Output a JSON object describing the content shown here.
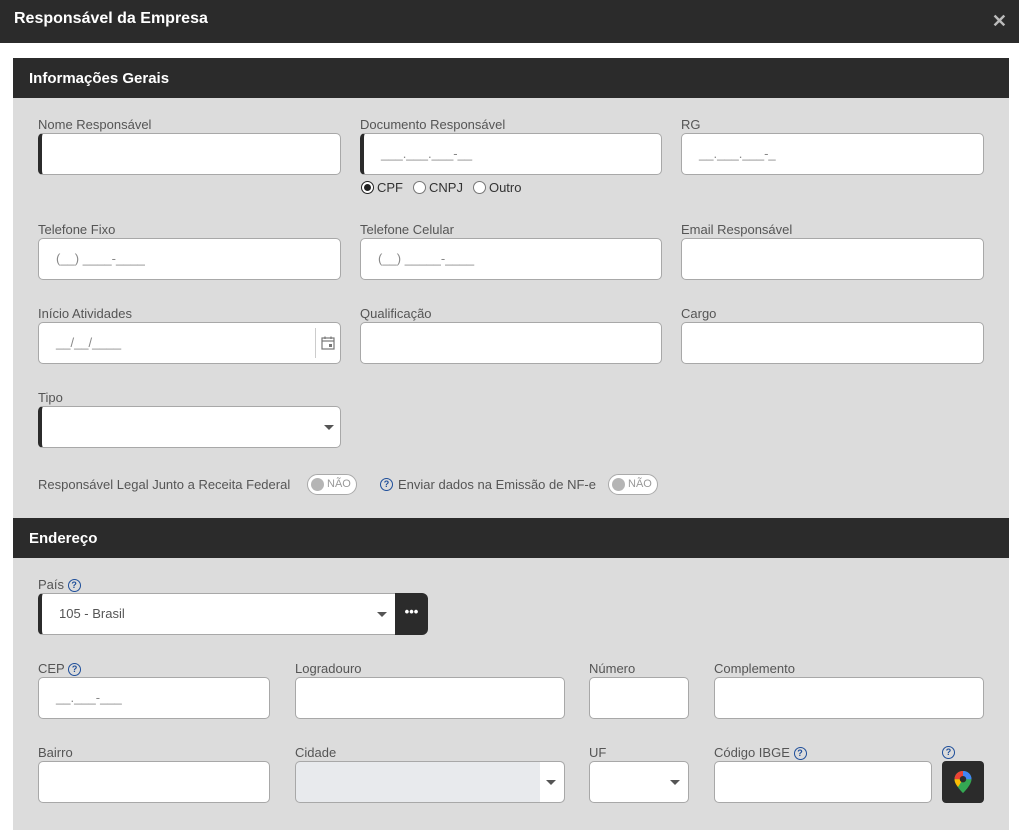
{
  "dialog": {
    "title": "Responsável da Empresa",
    "close_glyph": "✕"
  },
  "section_general": {
    "title": "Informações Gerais",
    "nome": {
      "label": "Nome Responsável",
      "value": ""
    },
    "documento": {
      "label": "Documento Responsável",
      "placeholder": "___.___.___-__"
    },
    "doc_types": [
      "CPF",
      "CNPJ",
      "Outro"
    ],
    "doc_type_selected": "CPF",
    "rg": {
      "label": "RG",
      "placeholder": "__.___.___-_"
    },
    "telefone_fixo": {
      "label": "Telefone Fixo",
      "placeholder": "(__) ____-____"
    },
    "telefone_celular": {
      "label": "Telefone Celular",
      "placeholder": "(__) _____-____"
    },
    "email": {
      "label": "Email Responsável",
      "value": ""
    },
    "inicio": {
      "label": "Início Atividades",
      "placeholder": "__/__/____"
    },
    "qualificacao": {
      "label": "Qualificação",
      "value": ""
    },
    "cargo": {
      "label": "Cargo",
      "value": ""
    },
    "tipo": {
      "label": "Tipo",
      "value": ""
    },
    "responsavel_legal": {
      "label": "Responsável Legal Junto a Receita Federal",
      "toggle": "NÃO"
    },
    "enviar_nfe": {
      "label": "Enviar dados na Emissão de NF-e",
      "toggle": "NÃO"
    }
  },
  "section_address": {
    "title": "Endereço",
    "pais": {
      "label": "País",
      "value": "105 - Brasil"
    },
    "cep": {
      "label": "CEP",
      "placeholder": "__.___-___"
    },
    "logradouro": {
      "label": "Logradouro",
      "value": ""
    },
    "numero": {
      "label": "Número",
      "value": ""
    },
    "complemento": {
      "label": "Complemento",
      "value": ""
    },
    "bairro": {
      "label": "Bairro",
      "value": ""
    },
    "cidade": {
      "label": "Cidade",
      "value": ""
    },
    "uf": {
      "label": "UF",
      "value": ""
    },
    "ibge": {
      "label": "Código IBGE",
      "value": ""
    }
  },
  "icons": {
    "help": "?",
    "more": "•••",
    "map": "map-pin-icon",
    "calendar": "calendar-icon"
  },
  "colors": {
    "header_bg": "#2b2b2b",
    "panel_bg": "#dcdcdc",
    "help_blue": "#1e4e9a"
  }
}
